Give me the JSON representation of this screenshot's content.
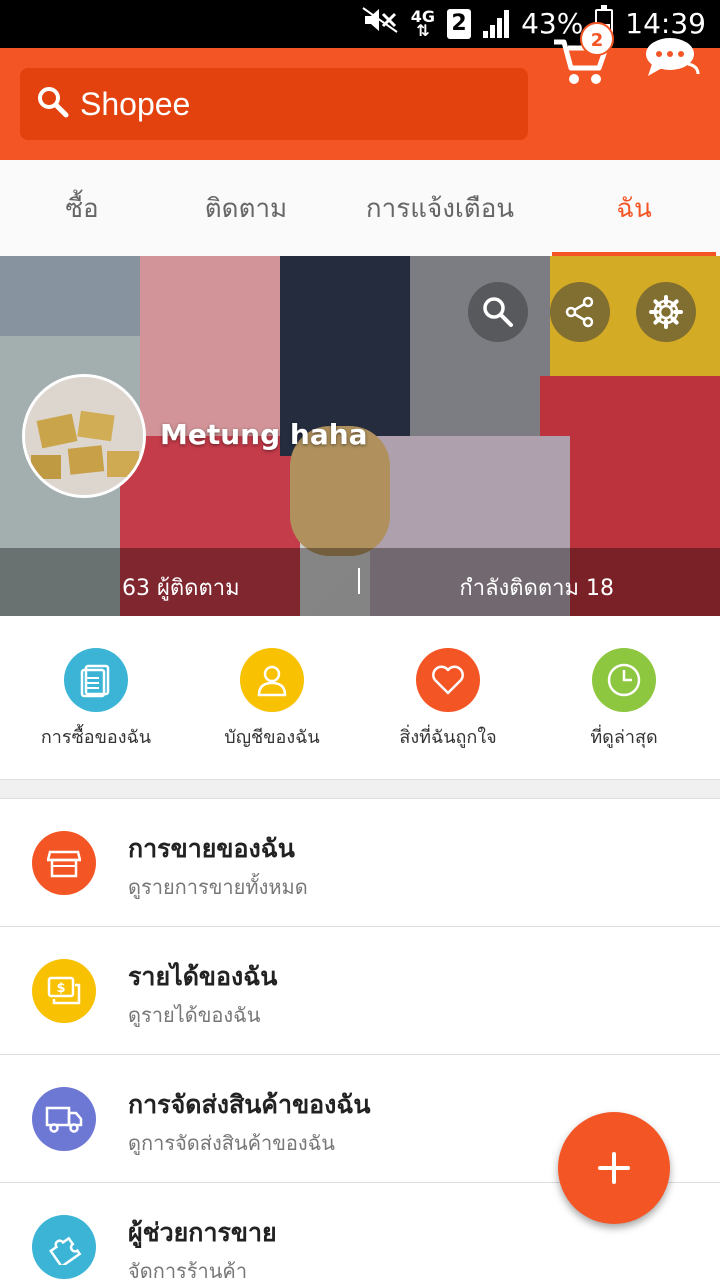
{
  "status_bar": {
    "sim_slot": "2",
    "network": "4G",
    "battery": "43%",
    "time": "14:39",
    "battery_level": 0.43
  },
  "app_bar": {
    "search_placeholder": "Shopee",
    "cart_count": "2"
  },
  "tabs": [
    {
      "label": "ซื้อ",
      "active": false
    },
    {
      "label": "ติดตาม",
      "active": false
    },
    {
      "label": "การแจ้งเตือน",
      "active": false
    },
    {
      "label": "ฉัน",
      "active": true
    }
  ],
  "profile": {
    "username": "Metung haha",
    "followers": "63 ผู้ติดตาม",
    "following": "กำลังติดตาม 18"
  },
  "quick_actions": [
    {
      "label": "การซื้อของฉัน",
      "icon": "document-icon",
      "color": "#3bb4d6"
    },
    {
      "label": "บัญชีของฉัน",
      "icon": "person-icon",
      "color": "#f8c101"
    },
    {
      "label": "สิ่งที่ฉันถูกใจ",
      "icon": "heart-icon",
      "color": "#f45525"
    },
    {
      "label": "ที่ดูล่าสุด",
      "icon": "clock-icon",
      "color": "#8dc63f"
    }
  ],
  "menu": [
    {
      "title": "การขายของฉัน",
      "subtitle": "ดูรายการขายทั้งหมด",
      "icon": "shop-icon",
      "color": "#f45525"
    },
    {
      "title": "รายได้ของฉัน",
      "subtitle": "ดูรายได้ของฉัน",
      "icon": "money-icon",
      "color": "#f8c101"
    },
    {
      "title": "การจัดส่งสินค้าของฉัน",
      "subtitle": "ดูการจัดส่งสินค้าของฉัน",
      "icon": "truck-icon",
      "color": "#6d78d5"
    },
    {
      "title": "ผู้ช่วยการขาย",
      "subtitle": "จัดการร้านค้า",
      "icon": "puzzle-icon",
      "color": "#3bb4d6"
    }
  ],
  "colors": {
    "brand": "#f45525",
    "brand_dark": "#e3420f"
  }
}
